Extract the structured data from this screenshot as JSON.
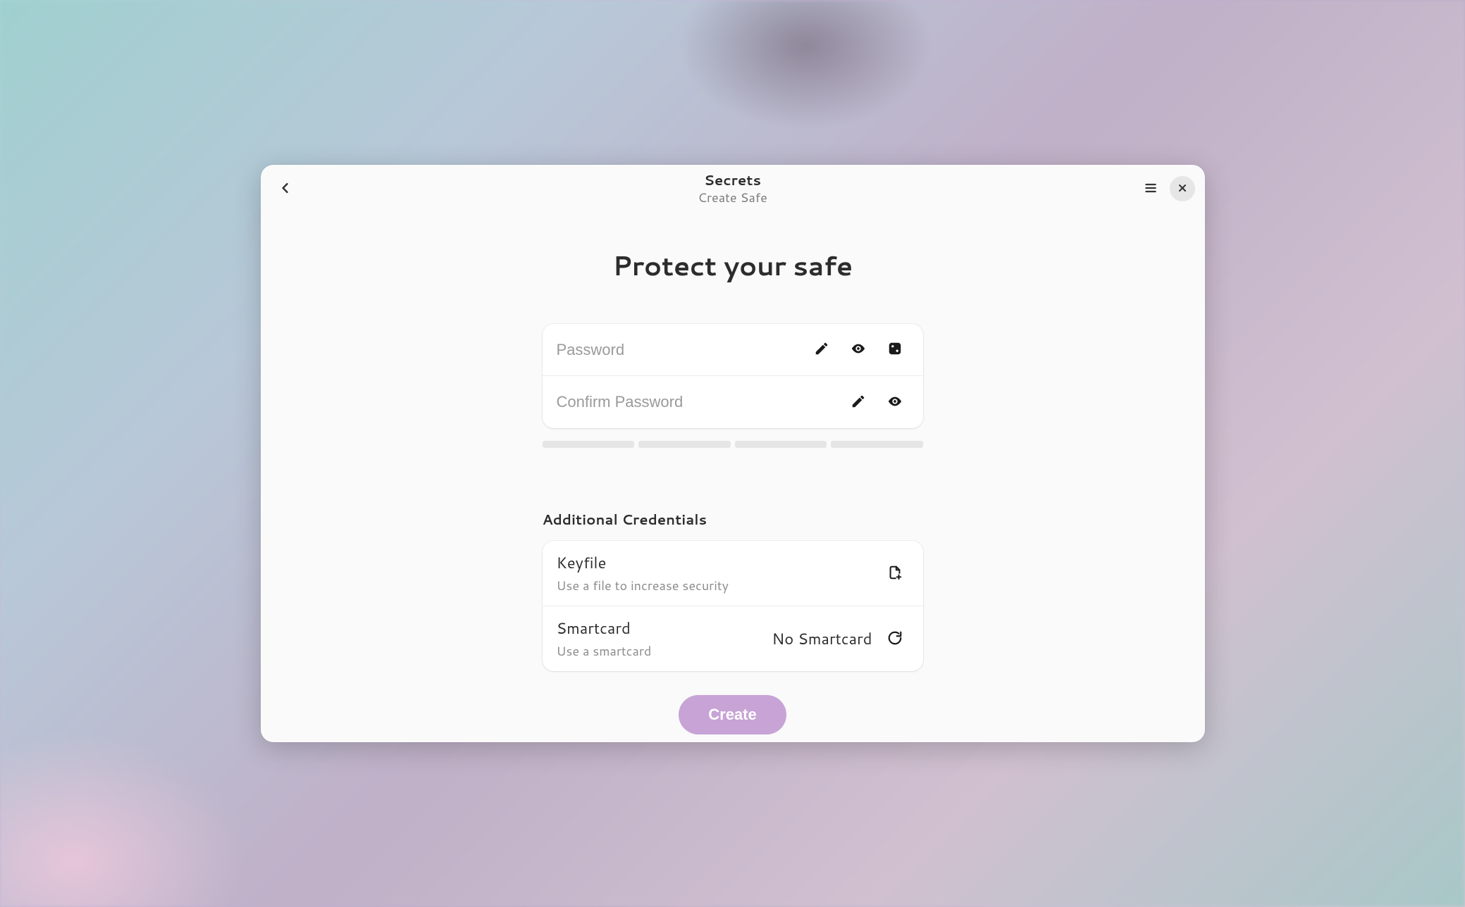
{
  "header": {
    "title": "Secrets",
    "subtitle": "Create Safe"
  },
  "main": {
    "heading": "Protect your safe",
    "password": {
      "placeholder": "Password",
      "value": ""
    },
    "confirm": {
      "placeholder": "Confirm Password",
      "value": ""
    },
    "strength_segments": 4,
    "additional_label": "Additional Credentials",
    "keyfile": {
      "title": "Keyfile",
      "subtitle": "Use a file to increase security"
    },
    "smartcard": {
      "title": "Smartcard",
      "subtitle": "Use a smartcard",
      "value": "No Smartcard"
    },
    "create_label": "Create"
  },
  "colors": {
    "accent": "#c7a3d6"
  },
  "icons": {
    "back": "chevron-left-icon",
    "menu": "hamburger-icon",
    "close": "close-icon",
    "edit": "pencil-icon",
    "reveal": "eye-icon",
    "generate": "dice-icon",
    "add_file": "file-add-icon",
    "refresh": "refresh-icon"
  }
}
